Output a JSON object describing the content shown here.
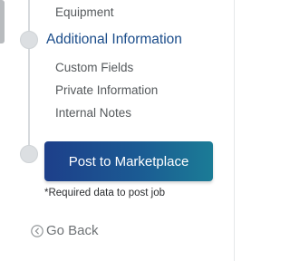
{
  "steps": {
    "previous_subitems": [
      "Equipment"
    ],
    "current": {
      "title": "Additional Information",
      "subitems": [
        "Custom Fields",
        "Private Information",
        "Internal Notes"
      ]
    }
  },
  "actions": {
    "post_label": "Post to Marketplace",
    "required_note": "*Required data to post job",
    "back_label": "Go Back"
  },
  "icons": {
    "back": "chevron-left-circle-icon"
  },
  "colors": {
    "accent_text": "#1a4c8a",
    "button_gradient_start": "#1d3f8a",
    "button_gradient_end": "#1b7c96"
  }
}
